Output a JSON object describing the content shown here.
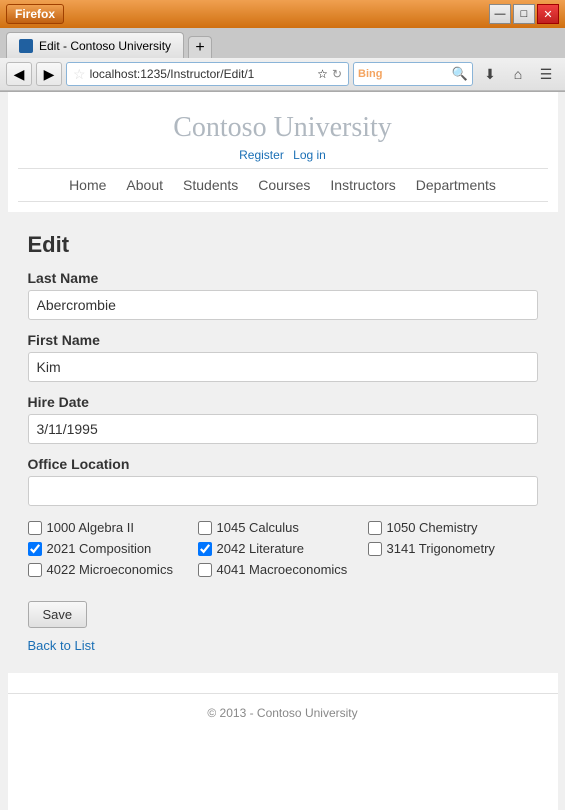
{
  "browser": {
    "firefox_label": "Firefox",
    "tab_title": "Edit - Contoso University",
    "new_tab_symbol": "+",
    "address": "localhost:1235/Instructor/Edit/1",
    "search_engine": "Bing",
    "minimize": "—",
    "maximize": "□",
    "close": "✕"
  },
  "site": {
    "title": "Contoso University",
    "auth": {
      "register": "Register",
      "login": "Log in"
    },
    "nav": [
      "Home",
      "About",
      "Students",
      "Courses",
      "Instructors",
      "Departments"
    ]
  },
  "page": {
    "heading": "Edit",
    "fields": {
      "last_name_label": "Last Name",
      "last_name_value": "Abercrombie",
      "first_name_label": "First Name",
      "first_name_value": "Kim",
      "hire_date_label": "Hire Date",
      "hire_date_value": "3/11/1995",
      "office_label": "Office Location",
      "office_value": ""
    },
    "courses": [
      {
        "id": "1000",
        "name": "Algebra II",
        "checked": false
      },
      {
        "id": "1045",
        "name": "Calculus",
        "checked": false
      },
      {
        "id": "1050",
        "name": "Chemistry",
        "checked": false
      },
      {
        "id": "2021",
        "name": "Composition",
        "checked": true
      },
      {
        "id": "2042",
        "name": "Literature",
        "checked": true
      },
      {
        "id": "3141",
        "name": "Trigonometry",
        "checked": false
      },
      {
        "id": "4022",
        "name": "Microeconomics",
        "checked": false
      },
      {
        "id": "4041",
        "name": "Macroeconomics",
        "checked": false
      }
    ],
    "save_button": "Save",
    "back_link": "Back to List"
  },
  "footer": {
    "text": "© 2013 - Contoso University"
  }
}
